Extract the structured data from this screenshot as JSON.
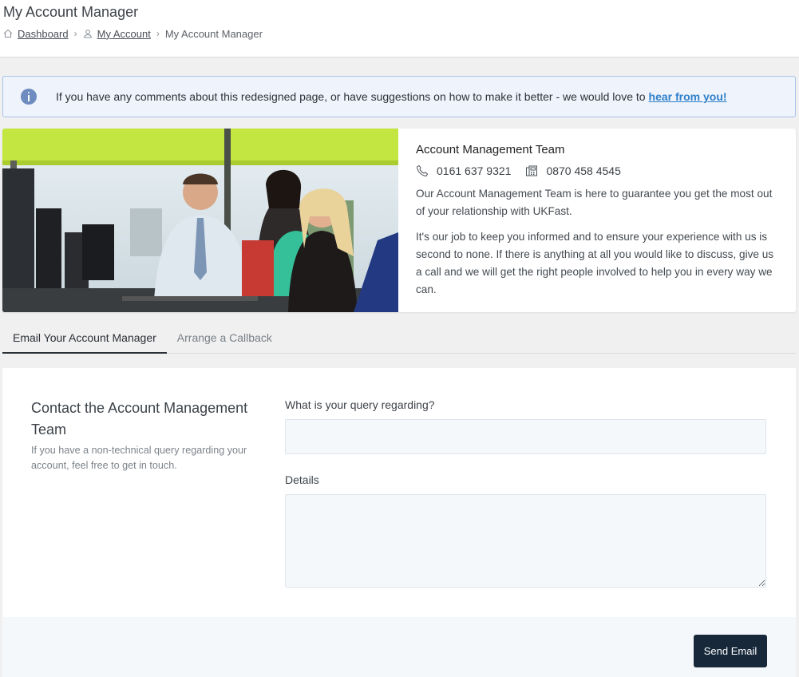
{
  "header": {
    "title": "My Account Manager",
    "breadcrumb": [
      {
        "label": "Dashboard",
        "icon": "home-icon"
      },
      {
        "label": "My Account",
        "icon": "user-icon"
      },
      {
        "label": "My Account Manager"
      }
    ]
  },
  "notice": {
    "text": "If you have any comments about this redesigned page, or have suggestions on how to make it better - we would love to",
    "link": "hear from you!",
    "icon": "info-icon"
  },
  "team": {
    "name": "Account Management Team",
    "phone": "0161 637 9321",
    "phone_icon": "phone-icon",
    "fax": "0870 458 4545",
    "fax_icon": "fax-icon",
    "paragraphs": [
      "Our Account Management Team is here to guarantee you get the most out of your relationship with UKFast.",
      "It's our job to keep you informed and to ensure your experience with us is second to none. If there is anything at all you would like to discuss, give us a call and we will get the right people involved to help you in every way we can."
    ]
  },
  "tabs": [
    {
      "label": "Email Your Account Manager",
      "active": true
    },
    {
      "label": "Arrange a Callback",
      "active": false
    }
  ],
  "form": {
    "heading": "Contact the Account Management Team",
    "subtext": "If you have a non-technical query regarding your account, feel free to get in touch.",
    "query_label": "What is your query regarding?",
    "query_value": "",
    "details_label": "Details",
    "details_value": "",
    "submit_label": "Send Email"
  },
  "colors": {
    "accent": "#16283a",
    "link": "#2f80c9",
    "notice_bg": "#eef3fc",
    "notice_border": "#a9c2ea"
  }
}
